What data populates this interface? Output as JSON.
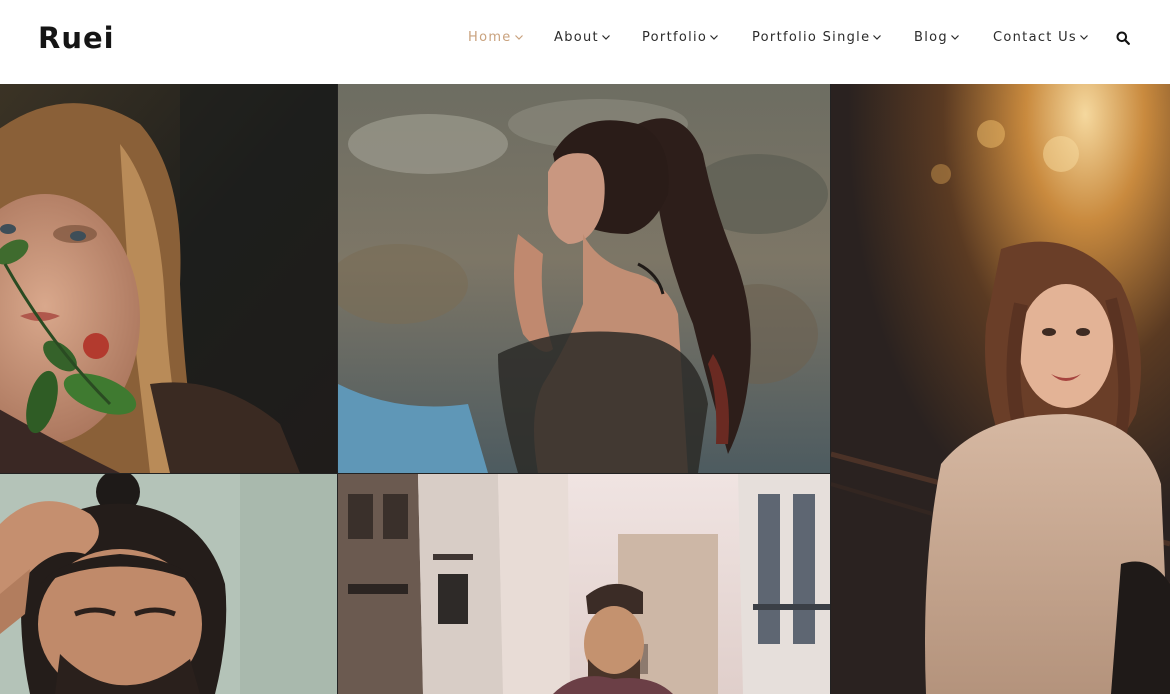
{
  "site": {
    "logo": "Ruei"
  },
  "nav": {
    "items": [
      {
        "label": "Home",
        "active": true
      },
      {
        "label": "About",
        "active": false
      },
      {
        "label": "Portfolio",
        "active": false
      },
      {
        "label": "Portfolio Single",
        "active": false
      },
      {
        "label": "Blog",
        "active": false
      },
      {
        "label": "Contact Us",
        "active": false
      }
    ],
    "icons": {
      "dropdown": "chevron-down-icon",
      "search": "search-icon"
    }
  },
  "colors": {
    "accent": "#c9a27e",
    "text": "#2b2b2b",
    "logo": "#151515"
  }
}
